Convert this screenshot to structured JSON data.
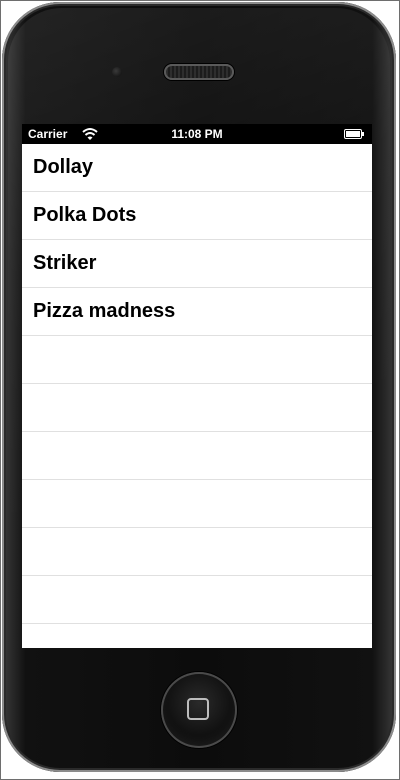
{
  "status_bar": {
    "carrier": "Carrier",
    "time": "11:08 PM",
    "wifi_icon": "wifi-icon",
    "battery_icon": "battery-icon"
  },
  "table": {
    "items": [
      {
        "label": "Dollay"
      },
      {
        "label": "Polka Dots"
      },
      {
        "label": "Striker"
      },
      {
        "label": "Pizza madness"
      }
    ],
    "empty_rows": 7
  },
  "device": {
    "home_button_icon": "home-button-icon",
    "speaker_icon": "speaker-grille-icon",
    "camera_icon": "front-camera-icon"
  },
  "colors": {
    "device_body": "#0c0c0c",
    "screen_bg": "#ffffff",
    "separator": "#e0e0e0",
    "status_bar_bg": "#000000"
  }
}
